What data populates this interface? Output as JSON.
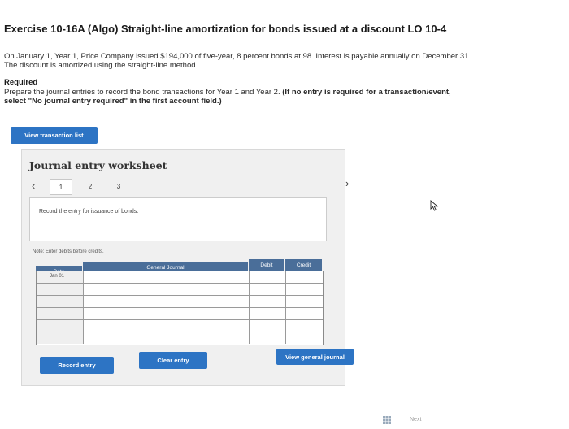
{
  "exercise": {
    "title": "Exercise 10-16A (Algo) Straight-line amortization for bonds issued at a discount LO 10-4",
    "intro_line1": "On January 1, Year 1, Price Company issued $194,000 of five-year, 8 percent bonds at 98. Interest is payable annually on December 31.",
    "intro_line2": "The discount is amortized using the straight-line method.",
    "required_heading": "Required",
    "required_line1_plain": "Prepare the journal entries to record the bond transactions for Year 1 and Year 2. ",
    "required_line1_bold": "(If no entry is required for a transaction/event,",
    "required_line2_bold": "select \"No journal entry required\" in the first account field.)"
  },
  "buttons": {
    "view_transaction_list": "View transaction list",
    "record_entry": "Record entry",
    "clear_entry": "Clear entry",
    "view_general_journal": "View general journal"
  },
  "worksheet": {
    "title": "Journal entry worksheet",
    "tabs": [
      "1",
      "2",
      "3"
    ],
    "active_tab": "1",
    "entry_instruction": "Record the entry for issuance of bonds.",
    "note": "Note: Enter debits before credits."
  },
  "table": {
    "headers": {
      "date": "Date",
      "general_journal": "General Journal",
      "debit": "Debit",
      "credit": "Credit"
    },
    "rows": [
      {
        "date": "Jan 01",
        "account": "",
        "debit": "",
        "credit": ""
      },
      {
        "date": "",
        "account": "",
        "debit": "",
        "credit": ""
      },
      {
        "date": "",
        "account": "",
        "debit": "",
        "credit": ""
      },
      {
        "date": "",
        "account": "",
        "debit": "",
        "credit": ""
      },
      {
        "date": "",
        "account": "",
        "debit": "",
        "credit": ""
      },
      {
        "date": "",
        "account": "",
        "debit": "",
        "credit": ""
      }
    ]
  },
  "footer": {
    "next_label": "Next"
  },
  "colors": {
    "accent": "#2d74c4",
    "table_header": "#4a6e99"
  }
}
